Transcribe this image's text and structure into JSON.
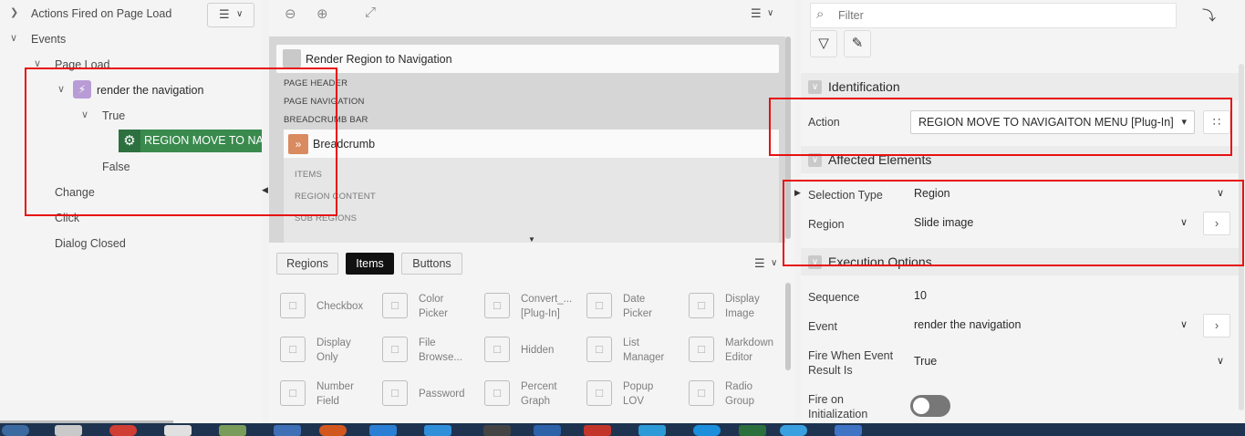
{
  "tree": {
    "actions_fired": "Actions Fired on Page Load",
    "events": "Events",
    "page_load": "Page Load",
    "dynamic_action": "render the navigation",
    "true_branch": "True",
    "action": "REGION MOVE TO NAVIGATION MENU",
    "false_branch": "False",
    "change": "Change",
    "click": "Click",
    "dialog_closed": "Dialog Closed"
  },
  "layout": {
    "page_region": "Render Region to Navigation",
    "page_header": "PAGE HEADER",
    "page_navigation": "PAGE NAVIGATION",
    "breadcrumb_bar": "BREADCRUMB BAR",
    "breadcrumb": "Breadcrumb",
    "items": "ITEMS",
    "region_content": "REGION CONTENT",
    "sub_regions": "SUB REGIONS"
  },
  "gallery": {
    "tabs": [
      "Regions",
      "Items",
      "Buttons"
    ],
    "active_tab": "Items",
    "items": [
      {
        "line1": "Checkbox",
        "line2": "",
        "icon": "checkbox-icon"
      },
      {
        "line1": "Color",
        "line2": "Picker",
        "icon": "color-picker-icon"
      },
      {
        "line1": "Convert_...",
        "line2": "[Plug-In]",
        "icon": "plug-icon"
      },
      {
        "line1": "Date",
        "line2": "Picker",
        "icon": "calendar-icon"
      },
      {
        "line1": "Display",
        "line2": "Image",
        "icon": "image-icon"
      },
      {
        "line1": "Display",
        "line2": "Only",
        "icon": "display-only-icon"
      },
      {
        "line1": "File",
        "line2": "Browse...",
        "icon": "file-browse-icon"
      },
      {
        "line1": "Hidden",
        "line2": "",
        "icon": "hidden-icon"
      },
      {
        "line1": "List",
        "line2": "Manager",
        "icon": "list-manager-icon"
      },
      {
        "line1": "Markdown",
        "line2": "Editor",
        "icon": "markdown-icon"
      },
      {
        "line1": "Number",
        "line2": "Field",
        "icon": "number-field-icon"
      },
      {
        "line1": "Password",
        "line2": "",
        "icon": "password-icon"
      },
      {
        "line1": "Percent",
        "line2": "Graph",
        "icon": "percent-graph-icon"
      },
      {
        "line1": "Popup",
        "line2": "LOV",
        "icon": "popup-lov-icon"
      },
      {
        "line1": "Radio",
        "line2": "Group",
        "icon": "radio-group-icon"
      }
    ]
  },
  "props": {
    "filter_placeholder": "Filter",
    "identification": "Identification",
    "action_label": "Action",
    "action_value": "REGION MOVE TO NAVIGAITON MENU [Plug-In]",
    "affected": "Affected Elements",
    "selection_type_label": "Selection Type",
    "selection_type_value": "Region",
    "region_label": "Region",
    "region_value": "Slide image",
    "execution": "Execution Options",
    "sequence_label": "Sequence",
    "sequence_value": "10",
    "event_label": "Event",
    "event_value": "render the navigation",
    "fire_when_label_1": "Fire When Event",
    "fire_when_label_2": "Result Is",
    "fire_when_value": "True",
    "fire_init_label_1": "Fire on",
    "fire_init_label_2": "Initialization"
  },
  "colors": {
    "annotation_red": "#e81010",
    "action_green": "#3a8a4e",
    "dynamic_action_purple": "#b89cd6",
    "breadcrumb_orange": "#d98a5f"
  }
}
